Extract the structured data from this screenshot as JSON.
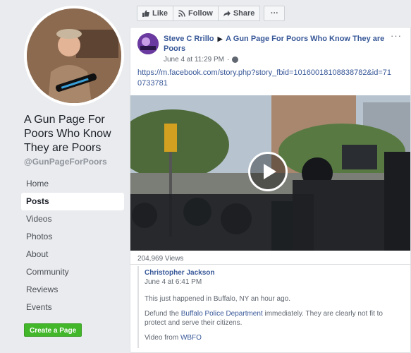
{
  "sidebar": {
    "page_name": "A Gun Page For Poors Who Know They are Poors",
    "handle": "@GunPageForPoors",
    "nav": [
      "Home",
      "Posts",
      "Videos",
      "Photos",
      "About",
      "Community",
      "Reviews",
      "Events"
    ],
    "active_nav": "Posts",
    "create_page": "Create a Page"
  },
  "actions": {
    "like": "Like",
    "follow": "Follow",
    "share": "Share",
    "more": "···"
  },
  "post": {
    "author": "Steve C Rrillo",
    "target": "A Gun Page For Poors Who Know They are Poors",
    "time": "June 4 at 11:29 PM",
    "link": "https://m.facebook.com/story.php?story_fbid=10160018108838782&id=710733781",
    "menu": "···",
    "views": "204,969 Views"
  },
  "shared": {
    "author": "Christopher Jackson",
    "time": "June 4 at 6:41 PM",
    "line1": "This just happened in Buffalo, NY an hour ago.",
    "line2_pre": "Defund the ",
    "line2_link": "Buffalo Police Department",
    "line2_post": " immediately. They are clearly not fit to protect and serve their citizens.",
    "line3_pre": "Video from ",
    "line3_link": "WBFO"
  },
  "colors": {
    "link": "#385898",
    "create_button": "#42b72a",
    "background": "#e9ebee"
  }
}
